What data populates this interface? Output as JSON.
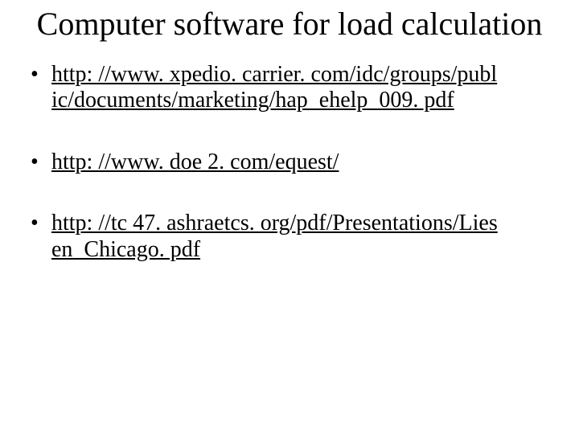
{
  "title": "Computer software for load calculation",
  "bullets": [
    {
      "text": "http: //www. xpedio. carrier. com/idc/groups/publ ic/documents/marketing/hap_ehelp_009. pdf"
    },
    {
      "text": "http: //www. doe 2. com/equest/"
    },
    {
      "text": "http: //tc 47. ashraetcs. org/pdf/Presentations/Lies en_Chicago. pdf"
    }
  ]
}
